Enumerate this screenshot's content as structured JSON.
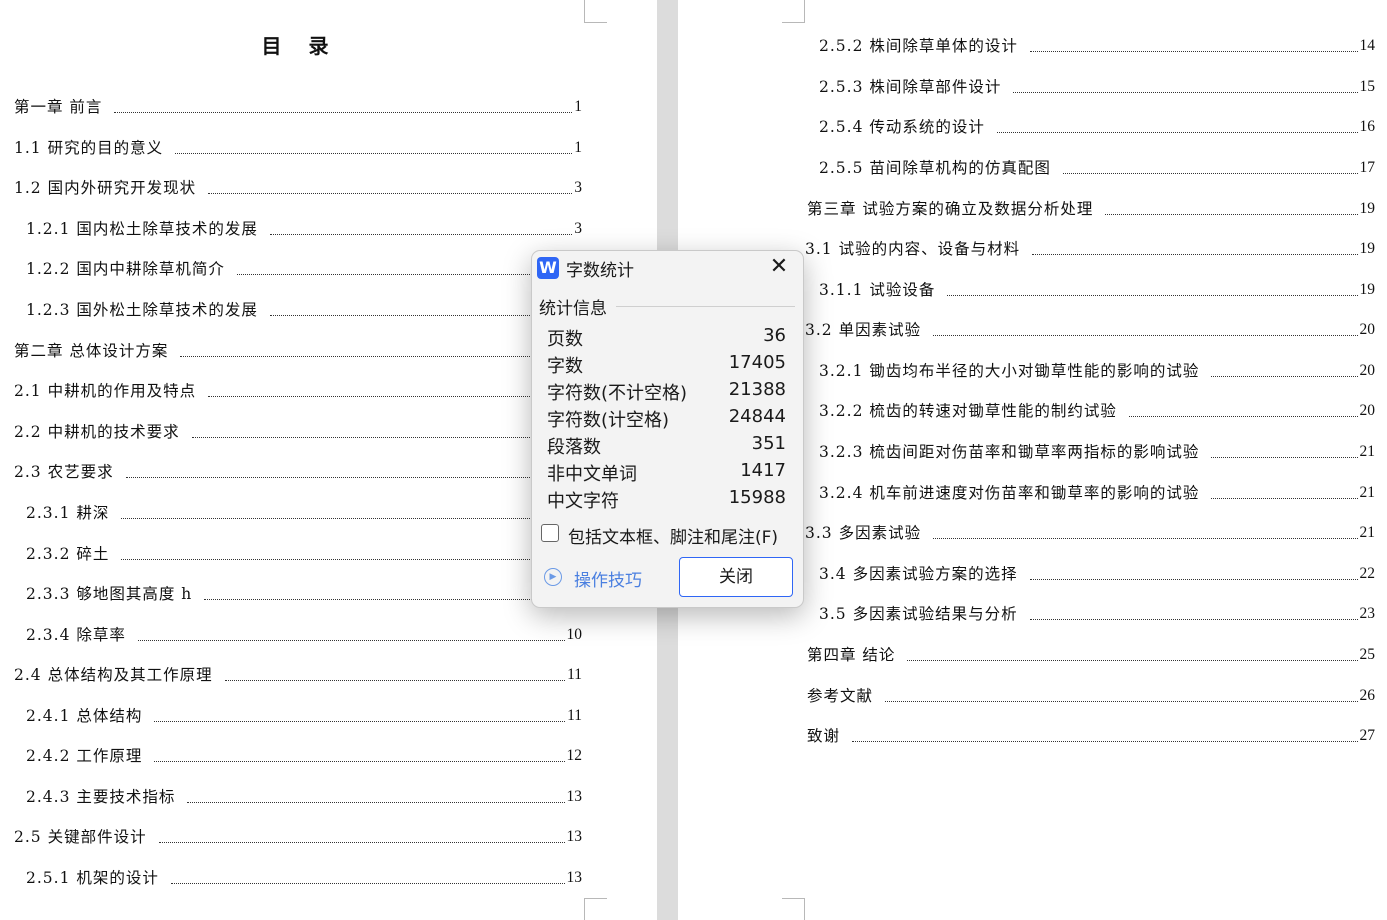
{
  "left_page": {
    "title": "目 录",
    "entries": [
      {
        "label": "第一章  前言",
        "page": "1"
      },
      {
        "label": "1.1  研究的目的意义",
        "page": "1"
      },
      {
        "label": "1.2  国内外研究开发现状",
        "page": "3"
      },
      {
        "label": "1.2.1  国内松土除草技术的发展",
        "page": "3"
      },
      {
        "label": "1.2.2  国内中耕除草机简介",
        "page": ""
      },
      {
        "label": "1.2.3  国外松土除草技术的发展",
        "page": ""
      },
      {
        "label": "第二章  总体设计方案",
        "page": ""
      },
      {
        "label": "2.1  中耕机的作用及特点",
        "page": ""
      },
      {
        "label": "2.2  中耕机的技术要求",
        "page": ""
      },
      {
        "label": "2.3  农艺要求",
        "page": ""
      },
      {
        "label": "2.3.1  耕深",
        "page": ""
      },
      {
        "label": "2.3.2  碎土",
        "page": ""
      },
      {
        "label": "2.3.3  够地图其高度 h",
        "page": ""
      },
      {
        "label": "2.3.4  除草率",
        "page": "10"
      },
      {
        "label": "2.4  总体结构及其工作原理",
        "page": "11"
      },
      {
        "label": "2.4.1  总体结构",
        "page": "11"
      },
      {
        "label": "2.4.2  工作原理",
        "page": "12"
      },
      {
        "label": "2.4.3  主要技术指标",
        "page": "13"
      },
      {
        "label": "2.5  关键部件设计",
        "page": "13"
      },
      {
        "label": "2.5.1  机架的设计",
        "page": "13"
      }
    ]
  },
  "right_page": {
    "entries": [
      {
        "label": "2.5.2  株间除草单体的设计",
        "page": "14"
      },
      {
        "label": "2.5.3  株间除草部件设计",
        "page": "15"
      },
      {
        "label": "2.5.4  传动系统的设计",
        "page": "16"
      },
      {
        "label": "2.5.5  苗间除草机构的仿真配图",
        "page": "17"
      },
      {
        "label": "第三章  试验方案的确立及数据分析处理",
        "page": "19"
      },
      {
        "label": "3.1  试验的内容、设备与材料",
        "page": "19"
      },
      {
        "label": "3.1.1  试验设备",
        "page": "19"
      },
      {
        "label": "3.2  单因素试验",
        "page": "20"
      },
      {
        "label": "3.2.1  锄齿均布半径的大小对锄草性能的影响的试验",
        "page": "20"
      },
      {
        "label": "3.2.2  梳齿的转速对锄草性能的制约试验",
        "page": "20"
      },
      {
        "label": "3.2.3  梳齿间距对伤苗率和锄草率两指标的影响试验",
        "page": "21"
      },
      {
        "label": "3.2.4  机车前进速度对伤苗率和锄草率的影响的试验",
        "page": "21"
      },
      {
        "label": "3.3  多因素试验",
        "page": "21"
      },
      {
        "label": "3.4  多因素试验方案的选择",
        "page": "22"
      },
      {
        "label": "3.5  多因素试验结果与分析",
        "page": "23"
      },
      {
        "label": "第四章  结论",
        "page": "25"
      },
      {
        "label": "参考文献",
        "page": "26"
      },
      {
        "label": "致谢",
        "page": "27"
      }
    ]
  },
  "dialog": {
    "app_icon": "W",
    "title": "字数统计",
    "section_label": "统计信息",
    "stats": [
      {
        "label": "页数",
        "value": "36"
      },
      {
        "label": "字数",
        "value": "17405"
      },
      {
        "label": "字符数(不计空格)",
        "value": "21388"
      },
      {
        "label": "字符数(计空格)",
        "value": "24844"
      },
      {
        "label": "段落数",
        "value": "351"
      },
      {
        "label": "非中文单词",
        "value": "1417"
      },
      {
        "label": "中文字符",
        "value": "15988"
      }
    ],
    "checkbox_label": "包括文本框、脚注和尾注(F)",
    "checkbox_checked": false,
    "tips_label": "操作技巧",
    "close_button_label": "关闭",
    "accent_color": "#2f66f5"
  }
}
